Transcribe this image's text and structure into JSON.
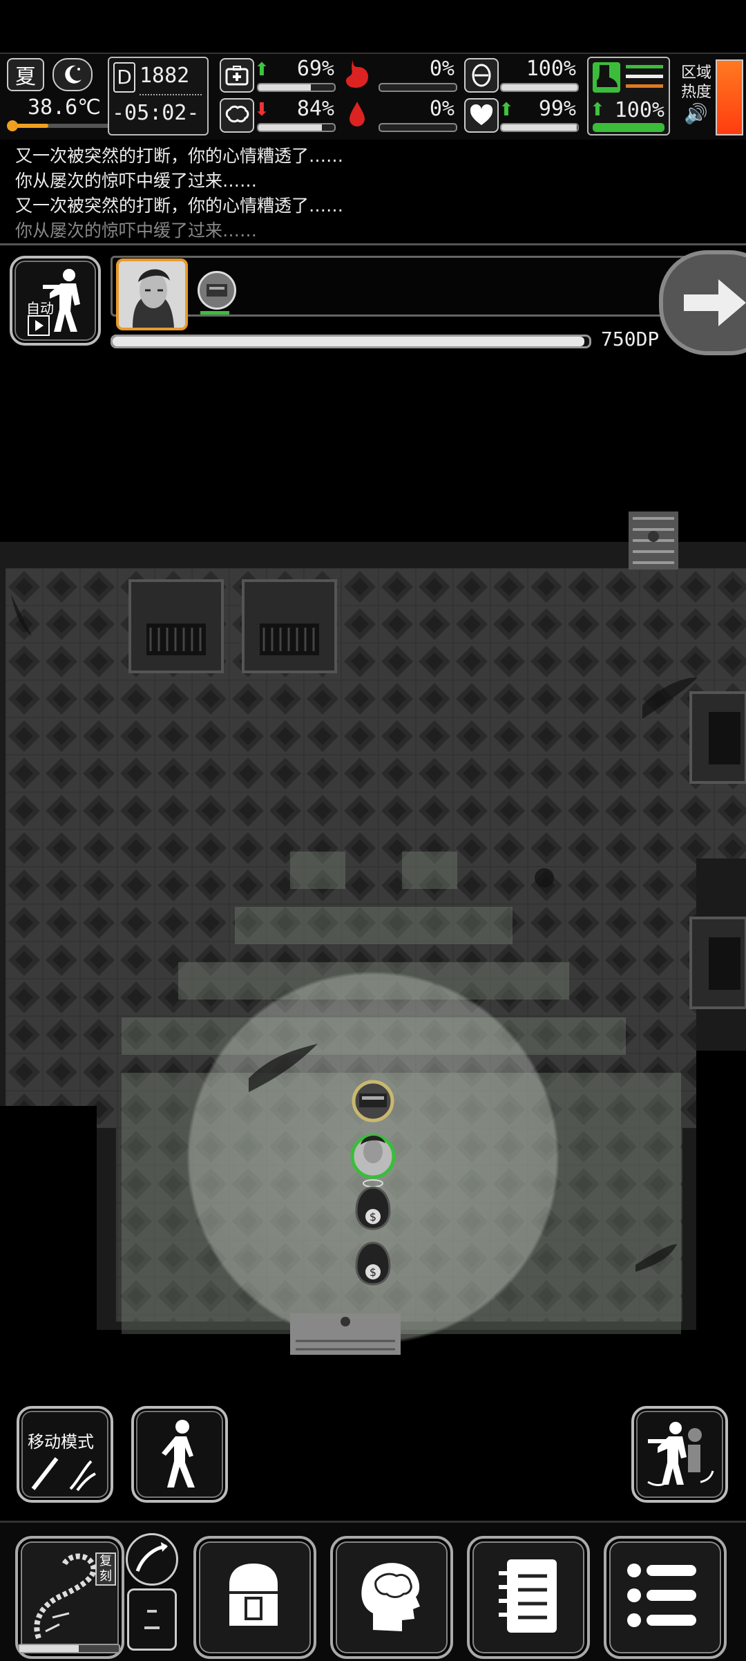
{
  "status": {
    "season": "夏",
    "time_of_day_icon": "moon-icon",
    "temperature": "38.6℃",
    "day": "1882",
    "day_prefix": "D",
    "clock": "-05:02-",
    "health": "69%",
    "health_trend": "up",
    "hunger": "0%",
    "stamina": "100%",
    "boots": "100%",
    "sanity": "84%",
    "sanity_trend": "down",
    "thirst": "0%",
    "mood": "99%",
    "mood_trend": "up",
    "endurance": "100%",
    "endurance_trend": "up",
    "zone_heat_label_1": "区域",
    "zone_heat_label_2": "热度",
    "colors": {
      "up": "#3ec43e",
      "down": "#e33333",
      "heat": "#ff6a1a",
      "green": "#3bbd3b"
    }
  },
  "bars": {
    "health": 0.69,
    "hunger": 0.0,
    "stamina": 1.0,
    "sanity": 0.84,
    "thirst": 0.0,
    "mood": 0.99,
    "endurance": 1.0
  },
  "log": [
    "又一次被突然的打断，你的心情糟透了……",
    "你从屡次的惊吓中缓了过来……",
    "又一次被突然的打断，你的心情糟透了……",
    "你从屡次的惊吓中缓了过来……"
  ],
  "action": {
    "auto_label": "自动",
    "progress_text": "750DP",
    "progress": 0.99
  },
  "controls": {
    "move_mode_label": "移动模式",
    "engrave_label": "复刻"
  },
  "icons": {
    "auto": "auto-combat-icon",
    "next": "arrow-right-icon",
    "walk": "walk-icon",
    "swap": "weapon-swap-icon",
    "bag": "backpack-icon",
    "brain": "brain-icon",
    "notes": "notes-icon",
    "menu": "menu-icon"
  }
}
